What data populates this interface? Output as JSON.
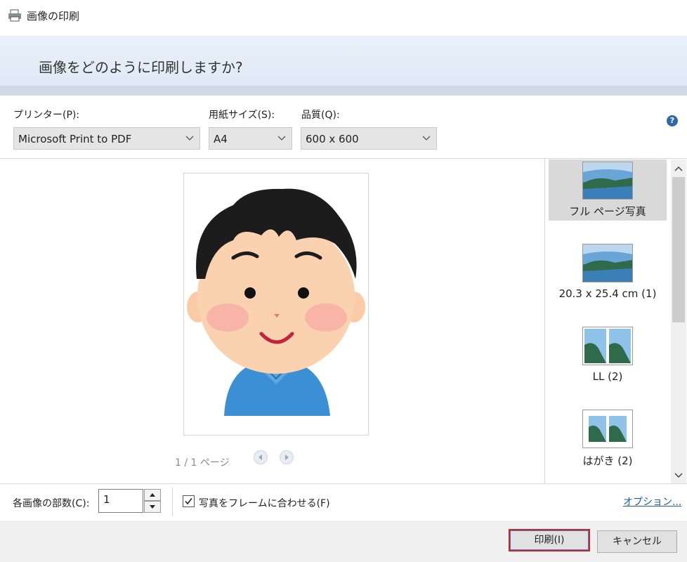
{
  "window": {
    "title": "画像の印刷"
  },
  "header": {
    "prompt": "画像をどのように印刷しますか?"
  },
  "options": {
    "printer_label": "プリンター(P):",
    "printer_value": "Microsoft Print to PDF",
    "paper_label": "用紙サイズ(S):",
    "paper_value": "A4",
    "quality_label": "品質(Q):",
    "quality_value": "600 x 600",
    "help_glyph": "?"
  },
  "preview": {
    "page_counter": "1 / 1 ページ"
  },
  "layouts": [
    {
      "label": "フル ページ写真",
      "selected": true
    },
    {
      "label": "20.3 x 25.4 cm (1)",
      "selected": false
    },
    {
      "label": "LL (2)",
      "selected": false
    },
    {
      "label": "はがき (2)",
      "selected": false
    }
  ],
  "bottom": {
    "copies_label": "各画像の部数(C):",
    "copies_value": "1",
    "fit_label": "写真をフレームに合わせる(F)",
    "fit_checked": true,
    "options_link": "オプション..."
  },
  "buttons": {
    "print": "印刷(I)",
    "cancel": "キャンセル"
  },
  "colors": {
    "accent_blue": "#2f6aa8",
    "print_border": "#d92020",
    "banner": "#e6eef8"
  }
}
